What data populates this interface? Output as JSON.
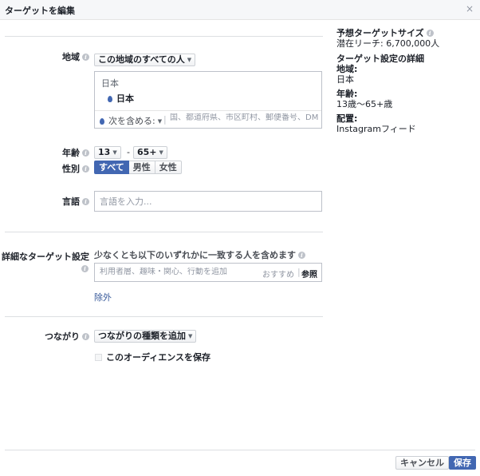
{
  "dialog": {
    "title": "ターゲットを編集",
    "close_label": "×"
  },
  "location": {
    "label": "地域",
    "scope_select": "この地域のすべての人",
    "country_heading": "日本",
    "selected_item": "日本",
    "mode_select": "次を含める:",
    "separator": "|",
    "search_placeholder": "国、都道府県、市区町村、郵便番号、DMA、住所"
  },
  "age": {
    "label": "年齢",
    "min": "13",
    "max": "65+",
    "dash": "-"
  },
  "gender": {
    "label": "性別",
    "options": [
      "すべて",
      "男性",
      "女性"
    ],
    "selected": "すべて"
  },
  "language": {
    "label": "言語",
    "placeholder": "言語を入力..."
  },
  "detailed_targeting": {
    "label": "詳細なターゲット設定",
    "description": "少なくとも以下のいずれかに一致する人を含めます",
    "placeholder": "利用者層、趣味・関心、行動を追加",
    "suggestions_label": "おすすめ",
    "separator": "|",
    "browse_label": "参照",
    "exclude_link": "除外"
  },
  "connections": {
    "label": "つながり",
    "select": "つながりの種類を追加",
    "save_audience_label": "このオーディエンスを保存"
  },
  "sidebar": {
    "audience_size_title": "予想ターゲットサイズ",
    "potential_reach": "潜在リーチ: 6,700,000人",
    "details_title": "ターゲット設定の詳細",
    "location_heading": "地域:",
    "location_value": "日本",
    "age_heading": "年齢:",
    "age_value": "13歳〜65+歳",
    "placement_heading": "配置:",
    "placement_value": "Instagramフィード"
  },
  "footer": {
    "cancel_label": "キャンセル",
    "save_label": "保存"
  },
  "colors": {
    "accent": "#4267b2",
    "link": "#365899",
    "header_bg": "#f6f7f9",
    "border": "#bdc1c9"
  }
}
